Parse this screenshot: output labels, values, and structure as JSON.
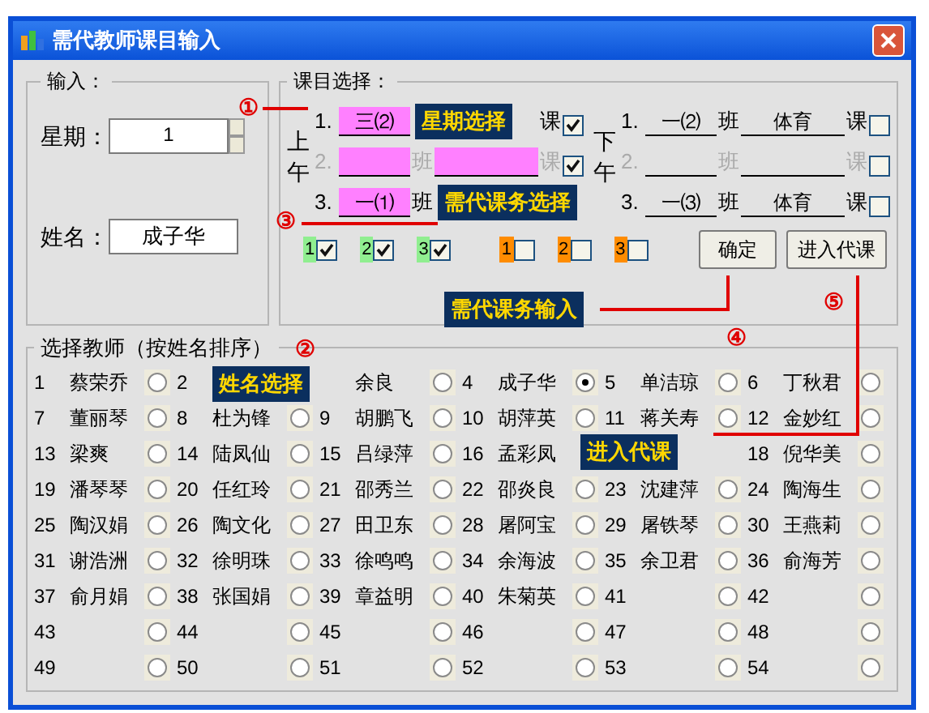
{
  "window": {
    "title": "需代教师课目输入"
  },
  "input_group": {
    "label": "输入：",
    "weekday_label": "星期：",
    "weekday_value": "1",
    "name_label": "姓名：",
    "name_value": "成子华"
  },
  "course_group": {
    "label": "课目选择：",
    "morning": {
      "side_label": "上午",
      "rows": [
        {
          "kind": "midcovered",
          "num": "1.",
          "class_name": "三⑵",
          "ke": "课",
          "checked": true,
          "highlighted": true,
          "disabled": false
        },
        {
          "kind": "open",
          "num": "2.",
          "ban": "班",
          "ke": "课",
          "checked": true,
          "highlighted": true,
          "disabled": true
        },
        {
          "kind": "tailcovered",
          "num": "3.",
          "class_name": "一⑴",
          "ban": "班",
          "highlighted": true,
          "disabled": false
        }
      ]
    },
    "afternoon": {
      "side_label": "下午",
      "rows": [
        {
          "kind": "open",
          "num": "1.",
          "class_name": "一⑵",
          "ban": "班",
          "subject": "体育",
          "ke": "课",
          "checked": false,
          "highlighted": false,
          "disabled": false
        },
        {
          "kind": "open",
          "num": "2.",
          "ban": "班",
          "ke": "课",
          "checked": false,
          "highlighted": false,
          "disabled": true
        },
        {
          "kind": "open",
          "num": "3.",
          "class_name": "一⑶",
          "ban": "班",
          "subject": "体育",
          "ke": "课",
          "checked": false,
          "highlighted": false,
          "disabled": false
        }
      ]
    },
    "period_checks": [
      {
        "label": "1",
        "color": "#90ee90",
        "checked": true
      },
      {
        "label": "2",
        "color": "#90ee90",
        "checked": true
      },
      {
        "label": "3",
        "color": "#90ee90",
        "checked": true
      },
      {
        "label": "1",
        "color": "#ff8c00",
        "checked": false
      },
      {
        "label": "2",
        "color": "#ff8c00",
        "checked": false
      },
      {
        "label": "3",
        "color": "#ff8c00",
        "checked": false
      }
    ],
    "buttons": [
      "确定",
      "进入代课"
    ]
  },
  "teacher_group": {
    "label": "选择教师（按姓名排序）",
    "teachers": [
      {
        "kind": "cell",
        "num": "1",
        "name": "蔡荣乔",
        "selected": false
      },
      {
        "kind": "cell",
        "num": "2"
      },
      {
        "kind": "cell",
        "name": "余良",
        "selected": false
      },
      {
        "kind": "cell",
        "num": "4",
        "name": "成子华",
        "selected": true
      },
      {
        "kind": "cell",
        "num": "5",
        "name": "单洁琼",
        "selected": false
      },
      {
        "kind": "cell",
        "num": "6",
        "name": "丁秋君",
        "selected": false
      },
      {
        "kind": "cell",
        "num": "7",
        "name": "董丽琴",
        "selected": false
      },
      {
        "kind": "cell",
        "num": "8",
        "name": "杜为锋",
        "selected": false
      },
      {
        "kind": "cell",
        "num": "9",
        "name": "胡鹏飞",
        "selected": false
      },
      {
        "kind": "cell",
        "num": "10",
        "name": "胡萍英",
        "selected": false
      },
      {
        "kind": "cell",
        "num": "11",
        "name": "蒋关寿",
        "selected": false
      },
      {
        "kind": "cell",
        "num": "12",
        "name": "金妙红",
        "selected": false
      },
      {
        "kind": "cell",
        "num": "13",
        "name": "梁爽",
        "selected": false
      },
      {
        "kind": "cell",
        "num": "14",
        "name": "陆凤仙",
        "selected": false
      },
      {
        "kind": "cell",
        "num": "15",
        "name": "吕绿萍",
        "selected": false
      },
      {
        "kind": "cell",
        "num": "16",
        "name": "孟彩凤"
      },
      {
        "kind": "covered"
      },
      {
        "kind": "cell",
        "num": "18",
        "name": "倪华美",
        "selected": false
      },
      {
        "kind": "cell",
        "num": "19",
        "name": "潘琴琴",
        "selected": false
      },
      {
        "kind": "cell",
        "num": "20",
        "name": "任红玲",
        "selected": false
      },
      {
        "kind": "cell",
        "num": "21",
        "name": "邵秀兰",
        "selected": false
      },
      {
        "kind": "cell",
        "num": "22",
        "name": "邵炎良",
        "selected": false
      },
      {
        "kind": "cell",
        "num": "23",
        "name": "沈建萍",
        "selected": false
      },
      {
        "kind": "cell",
        "num": "24",
        "name": "陶海生",
        "selected": false
      },
      {
        "kind": "cell",
        "num": "25",
        "name": "陶汉娟",
        "selected": false
      },
      {
        "kind": "cell",
        "num": "26",
        "name": "陶文化",
        "selected": false
      },
      {
        "kind": "cell",
        "num": "27",
        "name": "田卫东",
        "selected": false
      },
      {
        "kind": "cell",
        "num": "28",
        "name": "屠阿宝",
        "selected": false
      },
      {
        "kind": "cell",
        "num": "29",
        "name": "屠铁琴",
        "selected": false
      },
      {
        "kind": "cell",
        "num": "30",
        "name": "王燕莉",
        "selected": false
      },
      {
        "kind": "cell",
        "num": "31",
        "name": "谢浩洲",
        "selected": false
      },
      {
        "kind": "cell",
        "num": "32",
        "name": "徐明珠",
        "selected": false
      },
      {
        "kind": "cell",
        "num": "33",
        "name": "徐鸣鸣",
        "selected": false
      },
      {
        "kind": "cell",
        "num": "34",
        "name": "余海波",
        "selected": false
      },
      {
        "kind": "cell",
        "num": "35",
        "name": "余卫君",
        "selected": false
      },
      {
        "kind": "cell",
        "num": "36",
        "name": "俞海芳",
        "selected": false
      },
      {
        "kind": "cell",
        "num": "37",
        "name": "俞月娟",
        "selected": false
      },
      {
        "kind": "cell",
        "num": "38",
        "name": "张国娟",
        "selected": false
      },
      {
        "kind": "cell",
        "num": "39",
        "name": "章益明",
        "selected": false
      },
      {
        "kind": "cell",
        "num": "40",
        "name": "朱菊英",
        "selected": false
      },
      {
        "kind": "cell",
        "num": "41",
        "selected": false
      },
      {
        "kind": "cell",
        "num": "42",
        "selected": false
      },
      {
        "kind": "cell",
        "num": "43",
        "selected": false
      },
      {
        "kind": "cell",
        "num": "44",
        "selected": false
      },
      {
        "kind": "cell",
        "num": "45",
        "selected": false
      },
      {
        "kind": "cell",
        "num": "46",
        "selected": false
      },
      {
        "kind": "cell",
        "num": "47",
        "selected": false
      },
      {
        "kind": "cell",
        "num": "48",
        "selected": false
      },
      {
        "kind": "cell",
        "num": "49",
        "selected": false
      },
      {
        "kind": "cell",
        "num": "50",
        "selected": false
      },
      {
        "kind": "cell",
        "num": "51",
        "selected": false
      },
      {
        "kind": "cell",
        "num": "52",
        "selected": false
      },
      {
        "kind": "cell",
        "num": "53",
        "selected": false
      },
      {
        "kind": "cell",
        "num": "54",
        "selected": false
      }
    ]
  },
  "callouts": [
    {
      "mark": "①",
      "text": "星期选择"
    },
    {
      "mark": "②",
      "text": "姓名选择"
    },
    {
      "mark": "③",
      "text": "需代课务选择"
    },
    {
      "mark": "④",
      "text": "需代课务输入"
    },
    {
      "mark": "⑤",
      "text": "进入代课"
    }
  ]
}
